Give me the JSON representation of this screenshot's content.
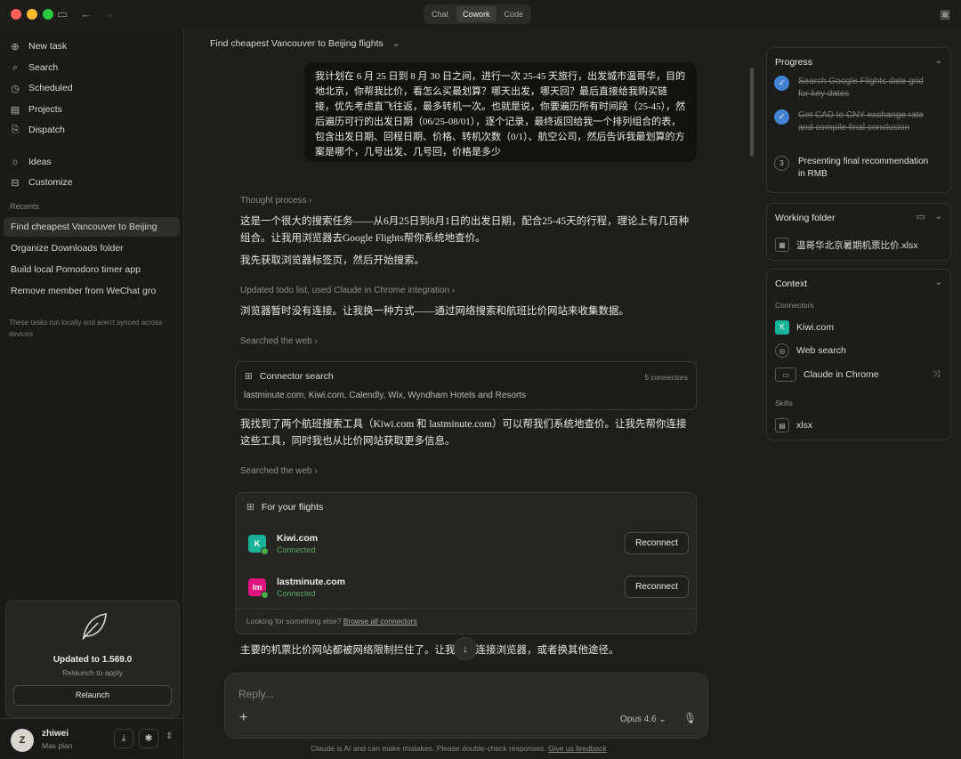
{
  "titlebar": {
    "modes": [
      "Chat",
      "Cowork",
      "Code"
    ],
    "active_mode": "Cowork"
  },
  "sidebar": {
    "nav": [
      {
        "label": "New task",
        "icon": "plus-icon"
      },
      {
        "label": "Search",
        "icon": "search-icon"
      },
      {
        "label": "Scheduled",
        "icon": "clock-icon"
      },
      {
        "label": "Projects",
        "icon": "folder-icon"
      },
      {
        "label": "Dispatch",
        "icon": "dispatch-icon"
      },
      {
        "label": "Ideas",
        "icon": "lightbulb-icon"
      },
      {
        "label": "Customize",
        "icon": "briefcase-icon"
      }
    ],
    "recents_heading": "Recents",
    "recents": [
      "Find cheapest Vancouver to Beijing",
      "Organize Downloads folder",
      "Build local Pomodoro timer app",
      "Remove member from WeChat gro"
    ],
    "note": "These tasks run locally and aren't synced across devices",
    "update": {
      "title": "Updated to 1.569.0",
      "subtitle": "Relaunch to apply",
      "button": "Relaunch"
    },
    "user": {
      "initial": "Z",
      "name": "zhiwei",
      "plan": "Max plan"
    }
  },
  "main": {
    "title": "Find cheapest Vancouver to Beijing flights",
    "user_message": "我计划在 6 月 25 日到 8 月 30 日之间，进行一次 25-45 天旅行，出发城市温哥华，目的地北京，你帮我比价，看怎么买最划算？哪天出发，哪天回？最后直接给我购买链接，优先考虑直飞往返，最多转机一次。也就是说，你要遍历所有时间段（25-45），然后遍历可行的出发日期（06/25-08/01），逐个记录，最终返回给我一个排列组合的表，包含出发日期、回程日期、价格、转机次数（0/1）、航空公司，然后告诉我最划算的方案是哪个，几号出发、几号回，价格是多少",
    "thought_process": "Thought process",
    "para1": "这是一个很大的搜索任务——从6月25日到8月1日的出发日期，配合25-45天的行程，理论上有几百种组合。让我用浏览器去Google Flights帮你系统地查价。",
    "para2": "我先获取浏览器标签页，然后开始搜索。",
    "step_todo": "Updated todo list, used Claude in Chrome integration",
    "para3": "浏览器暂时没有连接。让我换一种方式——通过网络搜索和航班比价网站来收集数据。",
    "searched_web_1": "Searched the web",
    "connector_search": {
      "title": "Connector search",
      "count": "5 connectors",
      "list": "lastminute.com, Kiwi.com, Calendly, Wix, Wyndham Hotels and Resorts"
    },
    "para4": "我找到了两个航班搜索工具（Kiwi.com 和 lastminute.com）可以帮我们系统地查价。让我先帮你连接这些工具，同时我也从比价网站获取更多信息。",
    "searched_web_2": "Searched the web",
    "flights_box": {
      "title": "For your flights",
      "items": [
        {
          "name": "Kiwi.com",
          "status": "Connected",
          "button": "Reconnect",
          "logo": "K",
          "logo_color": "#19b39a"
        },
        {
          "name": "lastminute.com",
          "status": "Connected",
          "button": "Reconnect",
          "logo": "lm",
          "logo_color": "#e0157f"
        }
      ],
      "footer_text": "Looking for something else?",
      "footer_link": "Browse all connectors"
    },
    "para5": "主要的机票比价网站都被网络限制拦住了。让我尝试连接浏览器，或者换其他途径。",
    "composer": {
      "placeholder": "Reply...",
      "model": "Opus 4.6"
    },
    "disclaimer": "Claude is AI and can make mistakes. Please double-check responses.",
    "disclaimer_link": "Give us feedback"
  },
  "right": {
    "progress": {
      "title": "Progress",
      "items": [
        {
          "text": "Search Google Flights date grid for key dates",
          "done": true
        },
        {
          "text": "Get CAD to CNY exchange rate and compile final conclusion",
          "done": true
        },
        {
          "text": "Presenting final recommendation in RMB",
          "done": false,
          "num": "3"
        }
      ]
    },
    "working_folder": {
      "title": "Working folder",
      "file": "温哥华北京暑期机票比价.xlsx"
    },
    "context": {
      "title": "Context",
      "connectors_label": "Connectors",
      "connectors": [
        "Kiwi.com",
        "Web search",
        "Claude in Chrome"
      ],
      "skills_label": "Skills",
      "skills": [
        "xlsx"
      ]
    }
  }
}
